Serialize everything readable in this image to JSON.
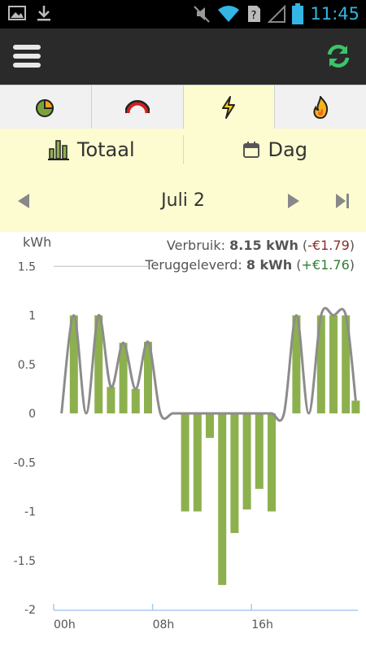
{
  "status_bar": {
    "time": "11:45",
    "icons": [
      "image-icon",
      "download-icon",
      "mute-icon",
      "wifi-icon",
      "no-sim-icon",
      "signal-icon",
      "battery-icon"
    ]
  },
  "app_bar": {
    "menu_icon": "hamburger-menu-icon",
    "refresh_icon": "refresh-icon",
    "accent_color": "#3cc46b"
  },
  "tabs": [
    {
      "icon": "gas-meter-icon",
      "active": false
    },
    {
      "icon": "gauge-icon",
      "active": false
    },
    {
      "icon": "electricity-icon",
      "active": true
    },
    {
      "icon": "flame-icon",
      "active": false
    }
  ],
  "view_toggle": {
    "total_label": "Totaal",
    "day_label": "Dag"
  },
  "date_nav": {
    "date": "Juli 2"
  },
  "summary": {
    "usage_label": "Verbruik:",
    "usage_value": "8.15 kWh",
    "usage_cost": "-€1.79",
    "return_label": "Teruggeleverd:",
    "return_value": "8 kWh",
    "return_cost": "+€1.76"
  },
  "chart_data": {
    "type": "bar",
    "ylabel": "kWh",
    "ylim": [
      -2,
      1.5
    ],
    "yticks": [
      "1.5",
      "1",
      "0.5",
      "0",
      "-0.5",
      "-1",
      "-1.5",
      "-2"
    ],
    "xtick_labels": [
      "00h",
      "08h",
      "16h"
    ],
    "bar_color": "#8db04e",
    "line_color": "#8c8c8c",
    "hours": [
      0.5,
      1.5,
      2.5,
      3.5,
      4.5,
      5.5,
      6.5,
      7.5,
      8.5,
      9.5,
      10.5,
      11.5,
      12.5,
      13.5,
      14.5,
      15.5,
      16.5,
      17.5,
      18.5,
      19.5,
      20.5,
      21.5,
      22.5,
      23.5
    ],
    "values": [
      0,
      1.0,
      0,
      1.0,
      0.27,
      0.72,
      0.25,
      0.73,
      0,
      0,
      -1.0,
      -1.0,
      -0.25,
      -1.75,
      -1.22,
      -0.98,
      -0.77,
      -1.0,
      0,
      1.0,
      0,
      1.0,
      1.0,
      1.0
    ],
    "extra_point": {
      "hour": 24.3,
      "value": 0.13
    },
    "line_points": [
      0,
      1.0,
      0,
      1.0,
      0.27,
      0.72,
      0.25,
      0.73,
      0,
      0,
      0,
      0,
      0,
      0,
      0,
      0,
      0,
      0,
      0,
      1.0,
      0,
      1.0,
      1.0,
      1.0,
      0.13
    ]
  }
}
